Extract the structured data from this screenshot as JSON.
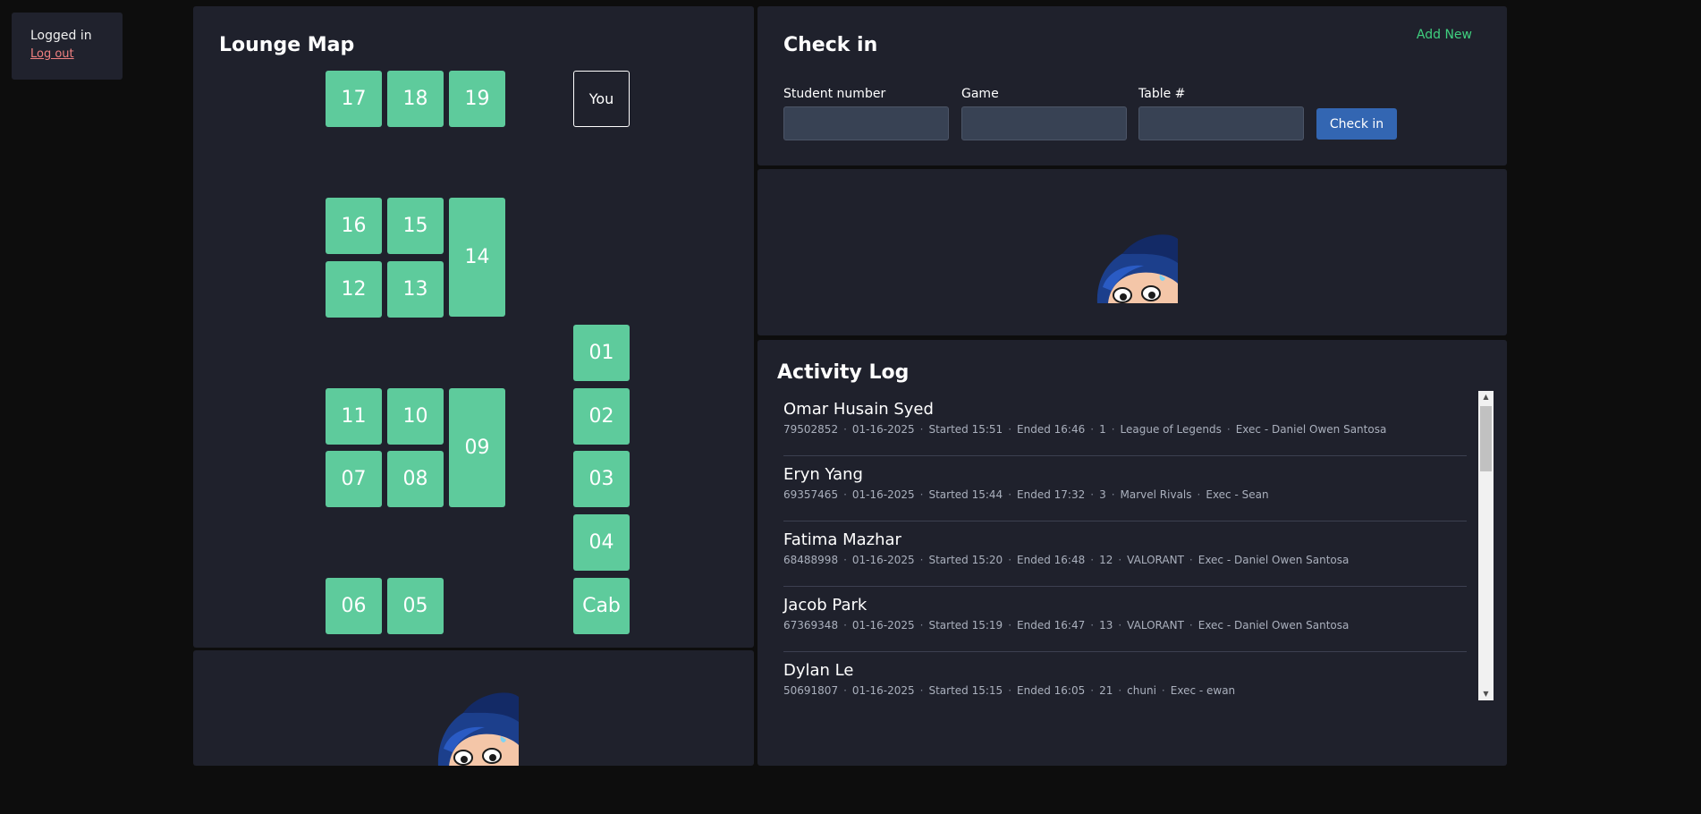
{
  "user": {
    "status": "Logged in",
    "logout_label": "Log out"
  },
  "map": {
    "title": "Lounge Map",
    "tiles": [
      "17",
      "18",
      "19",
      "You",
      "16",
      "15",
      "14",
      "12",
      "13",
      "01",
      "11",
      "10",
      "09",
      "02",
      "07",
      "08",
      "03",
      "04",
      "06",
      "05",
      "Cab"
    ]
  },
  "checkin": {
    "title": "Check in",
    "add_new_label": "Add New",
    "student_label": "Student number",
    "game_label": "Game",
    "table_label": "Table #",
    "button_label": "Check in"
  },
  "log": {
    "title": "Activity Log",
    "entries": [
      {
        "name": "Omar Husain Syed",
        "id": "79502852",
        "date": "01-16-2025",
        "started": "Started 15:51",
        "ended": "Ended 16:46",
        "table": "1",
        "game": "League of Legends",
        "exec": "Exec - Daniel Owen Santosa"
      },
      {
        "name": "Eryn Yang",
        "id": "69357465",
        "date": "01-16-2025",
        "started": "Started 15:44",
        "ended": "Ended 17:32",
        "table": "3",
        "game": "Marvel Rivals",
        "exec": "Exec - Sean"
      },
      {
        "name": "Fatima Mazhar",
        "id": "68488998",
        "date": "01-16-2025",
        "started": "Started 15:20",
        "ended": "Ended 16:48",
        "table": "12",
        "game": "VALORANT",
        "exec": "Exec - Daniel Owen Santosa"
      },
      {
        "name": "Jacob Park",
        "id": "67369348",
        "date": "01-16-2025",
        "started": "Started 15:19",
        "ended": "Ended 16:47",
        "table": "13",
        "game": "VALORANT",
        "exec": "Exec - Daniel Owen Santosa"
      },
      {
        "name": "Dylan Le",
        "id": "50691807",
        "date": "01-16-2025",
        "started": "Started 15:15",
        "ended": "Ended 16:05",
        "table": "21",
        "game": "chuni",
        "exec": "Exec - ewan"
      }
    ]
  },
  "colors": {
    "tile": "#5ecb9c",
    "panel": "#1f212c",
    "accent_green": "#3fd07f",
    "button_blue": "#3366b2",
    "logout_red": "#f08080"
  },
  "icons": {
    "mascot": "peeking-mascot-icon",
    "scroll_up": "scroll-up-arrow-icon",
    "scroll_down": "scroll-down-arrow-icon"
  }
}
